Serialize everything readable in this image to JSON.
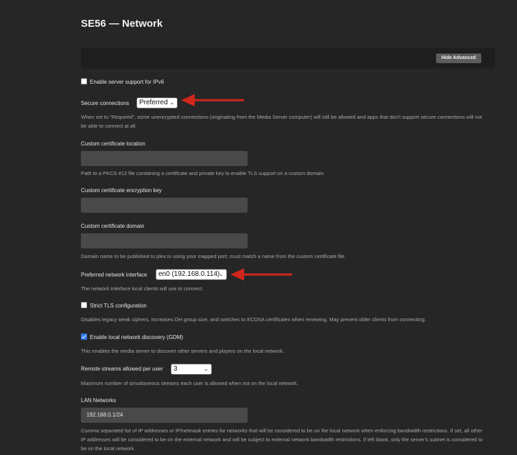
{
  "page": {
    "title": "SE56 — Network"
  },
  "toolbar": {
    "hide_advanced_label": "Hide Advanced"
  },
  "ipv6": {
    "label": "Enable server support for IPv6",
    "checked": false
  },
  "secure": {
    "label": "Secure connections",
    "value": "Preferred",
    "help": "When set to \"Required\", some unencrypted connections (originating from the Media Server computer) will still be allowed and apps that don't support secure connections will not be able to connect at all."
  },
  "cert_location": {
    "label": "Custom certificate location",
    "value": "",
    "help": "Path to a PKCS #12 file containing a certificate and private key to enable TLS support on a custom domain."
  },
  "cert_key": {
    "label": "Custom certificate encryption key",
    "value": ""
  },
  "cert_domain": {
    "label": "Custom certificate domain",
    "value": "",
    "help": "Domain name to be published to plex.tv using your mapped port; must match a name from the custom certificate file."
  },
  "interface": {
    "label": "Preferred network interface",
    "value": "en0 (192.168.0.114)",
    "help": "The network interface local clients will use to connect."
  },
  "strict_tls": {
    "label": "Strict TLS configuration",
    "checked": false,
    "help": "Disables legacy weak ciphers, increases DH group size, and switches to ECDSA certificates when renewing. May prevent older clients from connecting."
  },
  "gdm": {
    "label": "Enable local network discovery (GDM)",
    "checked": true,
    "help": "This enables the media server to discover other servers and players on the local network."
  },
  "streams": {
    "label": "Remote streams allowed per user",
    "value": "3",
    "help": "Maximum number of simultaneous streams each user is allowed when not on the local network."
  },
  "lan": {
    "label": "LAN Networks",
    "value": "192.168.0.1/24",
    "help": "Comma separated list of IP addresses or IP/netmask entries for networks that will be considered to be on the local network when enforcing bandwidth restrictions. If set, all other IP addresses will be considered to be on the external network and will be subject to external network bandwidth restrictions. If left blank, only the server's subnet is considered to be on the local network."
  },
  "colors": {
    "annotation_arrow": "#d0261b",
    "checkbox_checked": "#2f7bf6"
  }
}
